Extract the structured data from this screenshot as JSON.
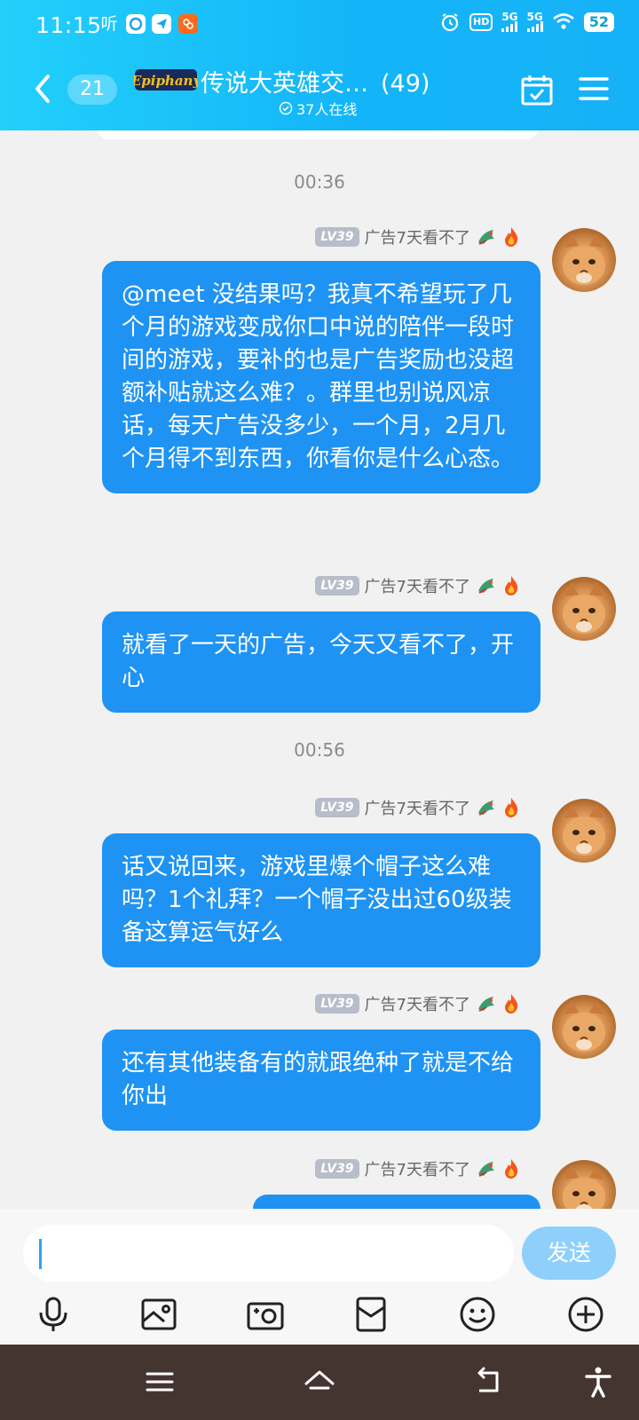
{
  "status_bar": {
    "time": "11:15",
    "app_ting": "听",
    "signal_1": "5G",
    "signal_2": "5G",
    "hd": "HD",
    "battery": "52"
  },
  "nav": {
    "unread_count": "21",
    "logo_text": "Epiphany",
    "group_name": "传说大英雄交…",
    "member_count": "(49)",
    "online_text": "37人在线"
  },
  "chat": {
    "timestamps": [
      "00:36",
      "00:56"
    ],
    "sender": {
      "level": "LV39",
      "nickname": "广告7天看不了"
    },
    "messages": [
      {
        "text": "@meet  没结果吗？我真不希望玩了几个月的游戏变成你口中说的陪伴一段时间的游戏，要补的也是广告奖励也没超额补贴就这么难？。群里也别说风凉话，每天广告没多少，一个月，2月几个月得不到东西，你看你是什么心态。"
      },
      {
        "text": "就看了一天的广告，今天又看不了，开心"
      },
      {
        "text": "话又说回来，游戏里爆个帽子这么难吗？1个礼拜？一个帽子没出过60级装备这算运气好么"
      },
      {
        "text": "还有其他装备有的就跟绝种了就是不给你出"
      }
    ]
  },
  "input_bar": {
    "input_value": "",
    "send_label": "发送",
    "tools": [
      "microphone-icon",
      "image-icon",
      "camera-icon",
      "red-packet-icon",
      "emoji-icon",
      "plus-icon"
    ]
  },
  "colors": {
    "header_gradient_start": "#22d0fb",
    "header_gradient_end": "#16b2f7",
    "bubble": "#1e93f3",
    "send_button": "#8ed0fb",
    "system_nav": "#453530"
  }
}
